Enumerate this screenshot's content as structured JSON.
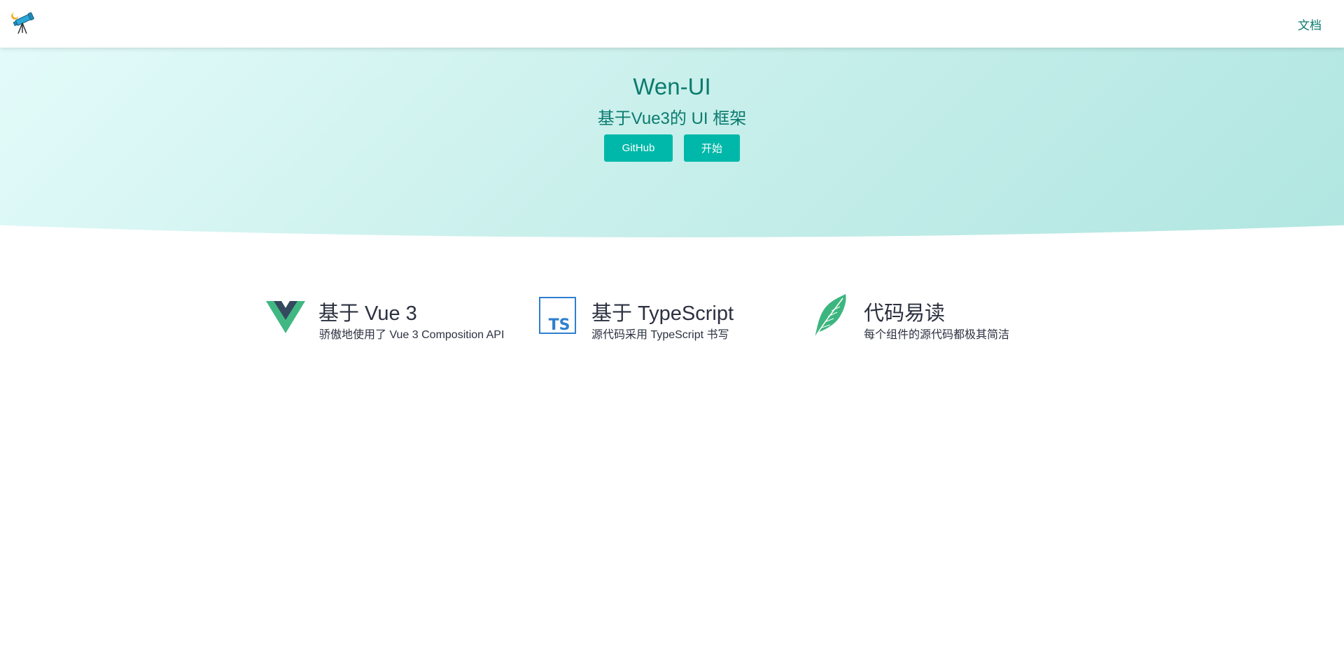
{
  "header": {
    "logo_icon": "telescope-icon",
    "nav_doc_label": "文档"
  },
  "hero": {
    "title": "Wen-UI",
    "subtitle": "基于Vue3的 UI 框架",
    "buttons": {
      "github_label": "GitHub",
      "start_label": "开始"
    },
    "colors": {
      "accent": "#00b8a9",
      "text": "#0c7b6f",
      "gradient_start": "#e3fbfa",
      "gradient_end": "#b1e6e1"
    }
  },
  "features": [
    {
      "icon": "vue-logo-icon",
      "title": "基于 Vue 3",
      "description": "骄傲地使用了 Vue 3 Composition API"
    },
    {
      "icon": "typescript-logo-icon",
      "title": "基于 TypeScript",
      "description": "源代码采用 TypeScript 书写"
    },
    {
      "icon": "feather-icon",
      "title": "代码易读",
      "description": "每个组件的源代码都极其简洁"
    }
  ]
}
